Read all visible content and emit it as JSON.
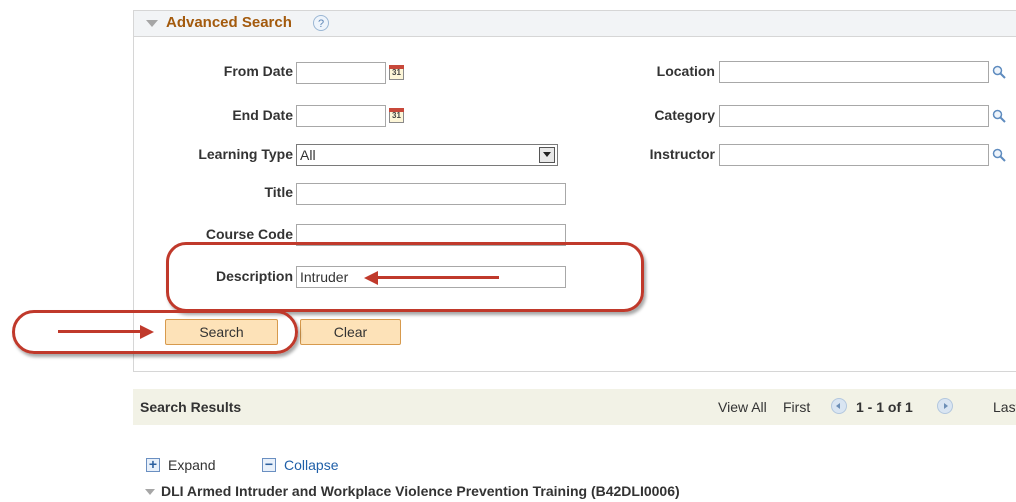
{
  "search_panel": {
    "title": "Advanced Search",
    "help_symbol": "?",
    "labels": {
      "from_date": "From Date",
      "end_date": "End Date",
      "learning_type": "Learning Type",
      "title": "Title",
      "course_code": "Course Code",
      "description": "Description",
      "location": "Location",
      "category": "Category",
      "instructor": "Instructor"
    },
    "values": {
      "from_date": "",
      "end_date": "",
      "learning_type": "All",
      "title": "",
      "course_code": "",
      "description": "Intruder",
      "location": "",
      "category": "",
      "instructor": ""
    },
    "calendar_icon_text": "31",
    "buttons": {
      "search": "Search",
      "clear": "Clear"
    }
  },
  "results": {
    "title": "Search Results",
    "view_all": "View All",
    "first": "First",
    "range": "1 - 1 of 1",
    "last": "Last",
    "expand_symbol": "+",
    "expand": "Expand",
    "collapse_symbol": "−",
    "collapse": "Collapse",
    "items": [
      {
        "title": "DLI Armed Intruder and Workplace Violence Prevention Training (B42DLI0006)"
      }
    ]
  },
  "colors": {
    "title_accent": "#a35a0d",
    "annotation_red": "#c0392b",
    "button_fill": "#fde2b8",
    "results_bar": "#f2f2e6",
    "link_blue": "#1f5fa8"
  },
  "icons": [
    "help-icon",
    "calendar-icon",
    "magnifier-icon",
    "dropdown-arrow-icon",
    "collapse-triangle-icon",
    "previous-icon",
    "next-icon",
    "plus-box-icon",
    "minus-box-icon"
  ]
}
